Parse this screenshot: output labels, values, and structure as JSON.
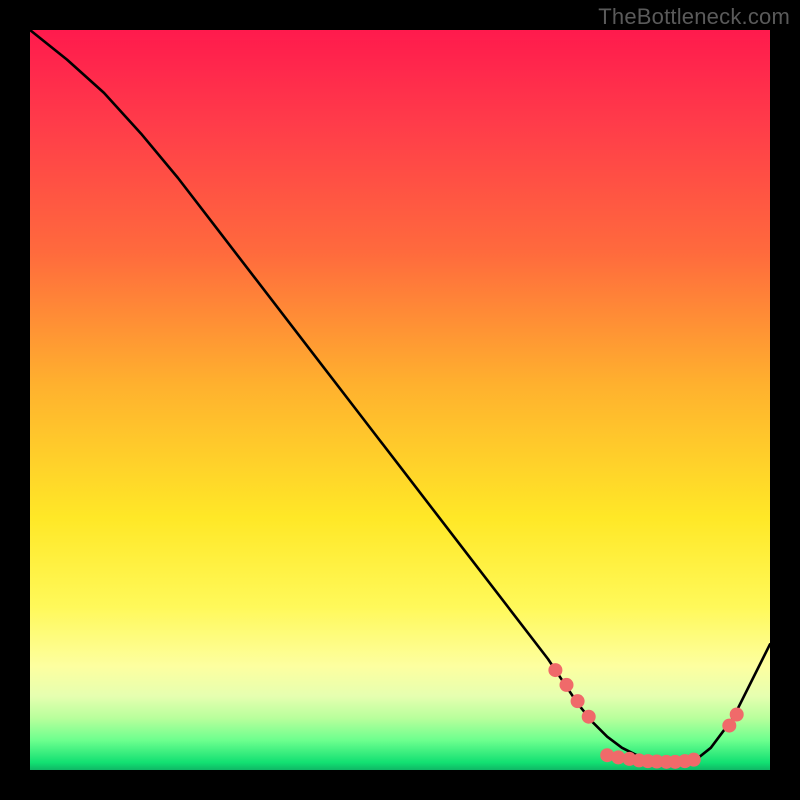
{
  "watermark": {
    "text": "TheBottleneck.com"
  },
  "chart_data": {
    "type": "line",
    "title": "",
    "xlabel": "",
    "ylabel": "",
    "xlim": [
      0,
      100
    ],
    "ylim": [
      0,
      100
    ],
    "series": [
      {
        "name": "curve",
        "x": [
          0,
          5,
          10,
          15,
          20,
          25,
          30,
          35,
          40,
          45,
          50,
          55,
          60,
          65,
          70,
          72,
          74,
          76,
          78,
          80,
          82,
          84,
          86,
          88,
          90,
          92,
          95,
          100
        ],
        "y": [
          100,
          96,
          91.5,
          86,
          80,
          73.5,
          67,
          60.5,
          54,
          47.5,
          41,
          34.5,
          28,
          21.5,
          15,
          12,
          9,
          6.5,
          4.5,
          3,
          2,
          1.4,
          1.1,
          1,
          1.4,
          3,
          7,
          17
        ]
      }
    ],
    "markers": [
      {
        "x": 71,
        "y": 13.5
      },
      {
        "x": 72.5,
        "y": 11.5
      },
      {
        "x": 74,
        "y": 9.3
      },
      {
        "x": 75.5,
        "y": 7.2
      },
      {
        "x": 78,
        "y": 2.0
      },
      {
        "x": 79.5,
        "y": 1.7
      },
      {
        "x": 81,
        "y": 1.5
      },
      {
        "x": 82.3,
        "y": 1.3
      },
      {
        "x": 83.5,
        "y": 1.2
      },
      {
        "x": 84.7,
        "y": 1.15
      },
      {
        "x": 86,
        "y": 1.1
      },
      {
        "x": 87.2,
        "y": 1.1
      },
      {
        "x": 88.5,
        "y": 1.2
      },
      {
        "x": 89.7,
        "y": 1.4
      },
      {
        "x": 94.5,
        "y": 6
      },
      {
        "x": 95.5,
        "y": 7.5
      }
    ],
    "marker_color": "#f06a6a",
    "curve_color": "#000000",
    "gradient": [
      "#ff1a4d",
      "#ffe827",
      "#12e072"
    ]
  }
}
